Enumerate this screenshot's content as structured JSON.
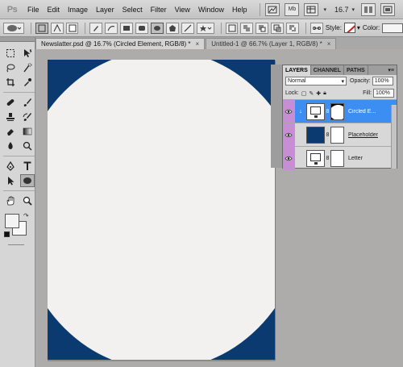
{
  "menubar": {
    "logo": "Ps",
    "items": [
      "File",
      "Edit",
      "Image",
      "Layer",
      "Select",
      "Filter",
      "View",
      "Window",
      "Help"
    ],
    "mb_label": "Mb",
    "zoom": "16.7"
  },
  "options": {
    "style_label": "Style:",
    "color_label": "Color:"
  },
  "tabs": [
    {
      "label": "Newslatter.psd @ 16.7% (Circled Element, RGB/8) *",
      "close": "×",
      "active": true
    },
    {
      "label": "Untitled-1 @ 66.7% (Layer 1, RGB/8) *",
      "close": "×",
      "active": false
    }
  ],
  "canvas": {
    "page_color": "#f2f1ef",
    "element_color": "#0b3a70"
  },
  "layers_panel": {
    "tabs": [
      "LAYERS",
      "CHANNEL",
      "PATHS"
    ],
    "blend_mode": "Normal",
    "opacity_label": "Opacity:",
    "opacity_value": "100%",
    "lock_label": "Lock:",
    "fill_label": "Fill:",
    "fill_value": "100%",
    "layers": [
      {
        "name": "Circled E...",
        "selected": true
      },
      {
        "name": "Placeholder",
        "selected": false
      },
      {
        "name": "Letter",
        "selected": false
      }
    ]
  },
  "colors": {
    "selection": "#3d8ef2",
    "visibility_column": "#c78ed6"
  }
}
